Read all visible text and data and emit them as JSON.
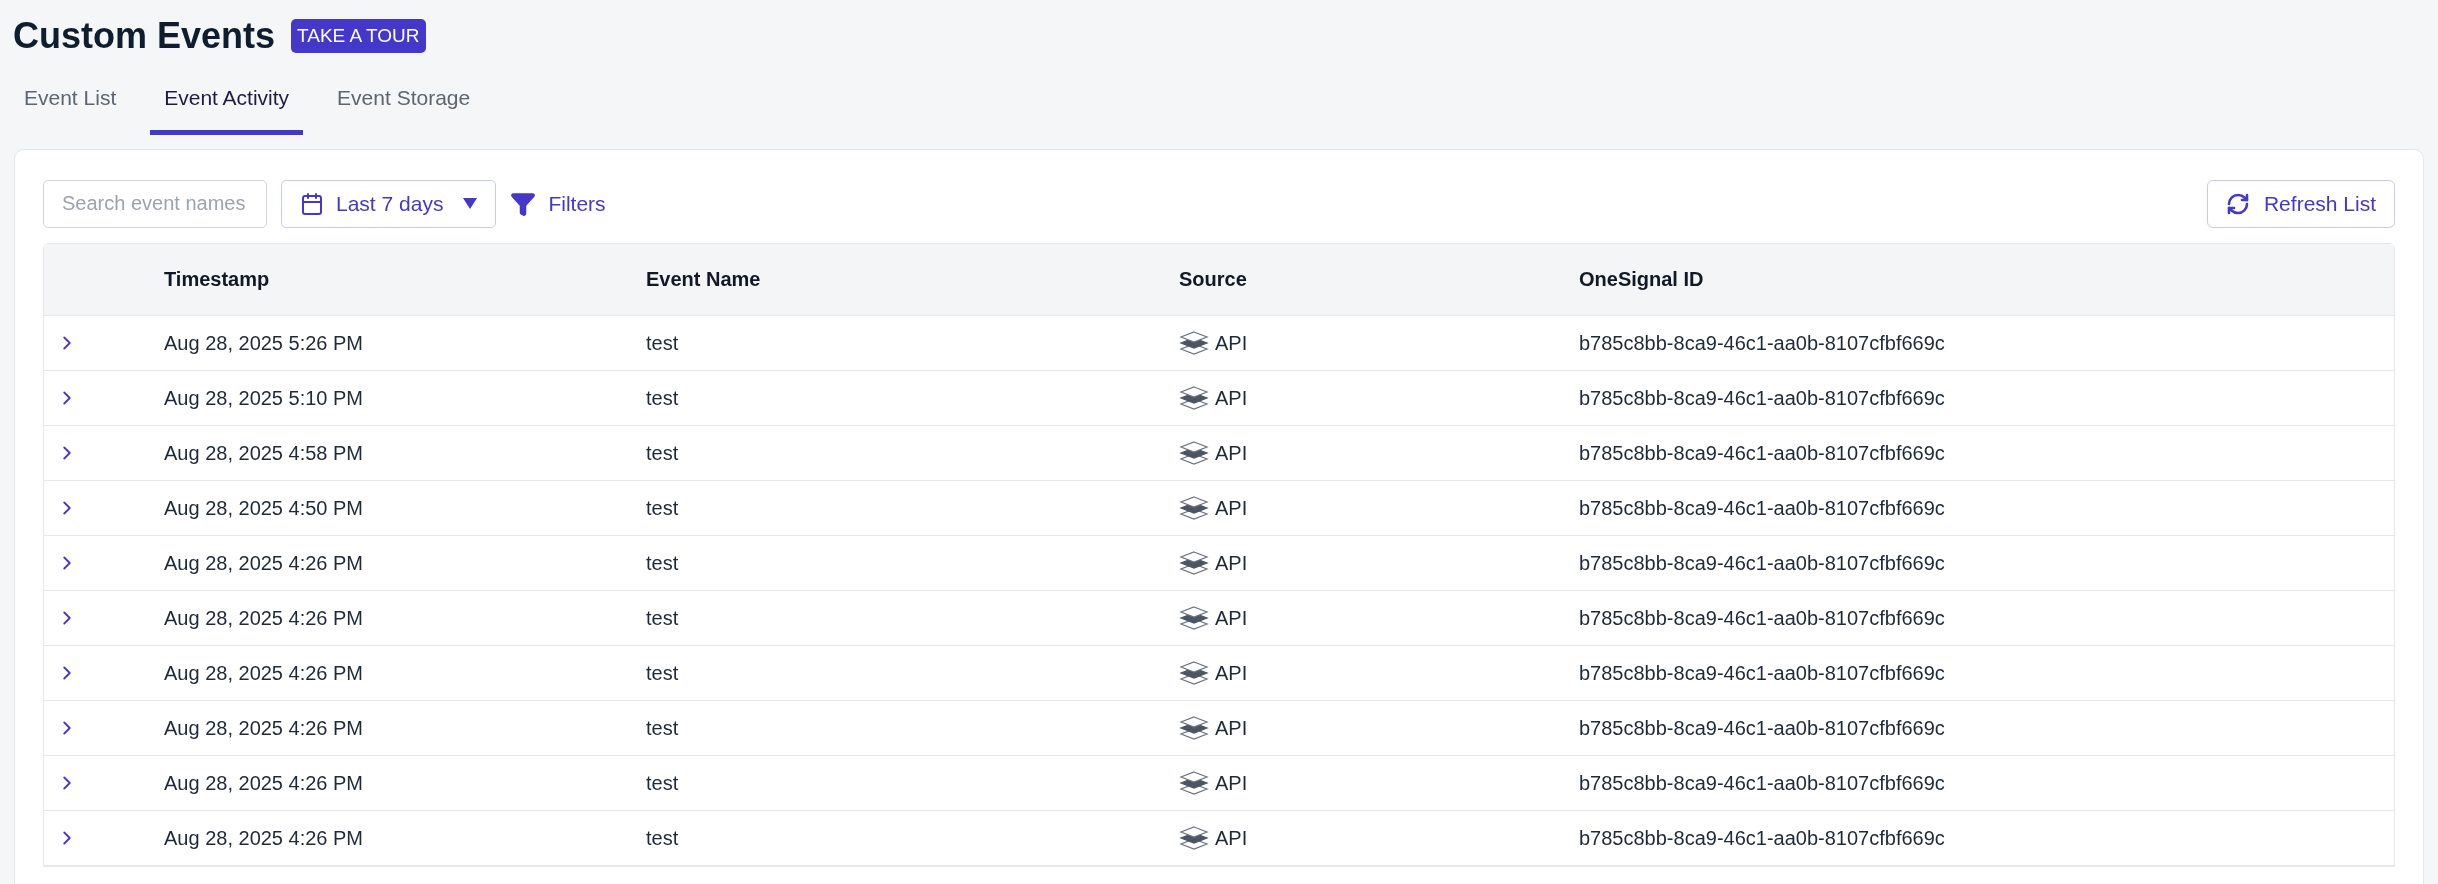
{
  "page": {
    "title": "Custom Events",
    "tour_button": "TAKE A TOUR"
  },
  "tabs": [
    {
      "label": "Event List",
      "selected": false
    },
    {
      "label": "Event Activity",
      "selected": true
    },
    {
      "label": "Event Storage",
      "selected": false
    }
  ],
  "toolbar": {
    "search": {
      "placeholder": "Search event names"
    },
    "date_range": "Last 7 days",
    "filters": "Filters",
    "refresh": "Refresh List"
  },
  "table": {
    "columns": [
      "Timestamp",
      "Event Name",
      "Source",
      "OneSignal ID"
    ],
    "rows": [
      {
        "timestamp": "Aug 28, 2025 5:26 PM",
        "event_name": "test",
        "source": "API",
        "onesignal_id": "b785c8bb-8ca9-46c1-aa0b-8107cfbf669c"
      },
      {
        "timestamp": "Aug 28, 2025 5:10 PM",
        "event_name": "test",
        "source": "API",
        "onesignal_id": "b785c8bb-8ca9-46c1-aa0b-8107cfbf669c"
      },
      {
        "timestamp": "Aug 28, 2025 4:58 PM",
        "event_name": "test",
        "source": "API",
        "onesignal_id": "b785c8bb-8ca9-46c1-aa0b-8107cfbf669c"
      },
      {
        "timestamp": "Aug 28, 2025 4:50 PM",
        "event_name": "test",
        "source": "API",
        "onesignal_id": "b785c8bb-8ca9-46c1-aa0b-8107cfbf669c"
      },
      {
        "timestamp": "Aug 28, 2025 4:26 PM",
        "event_name": "test",
        "source": "API",
        "onesignal_id": "b785c8bb-8ca9-46c1-aa0b-8107cfbf669c"
      },
      {
        "timestamp": "Aug 28, 2025 4:26 PM",
        "event_name": "test",
        "source": "API",
        "onesignal_id": "b785c8bb-8ca9-46c1-aa0b-8107cfbf669c"
      },
      {
        "timestamp": "Aug 28, 2025 4:26 PM",
        "event_name": "test",
        "source": "API",
        "onesignal_id": "b785c8bb-8ca9-46c1-aa0b-8107cfbf669c"
      },
      {
        "timestamp": "Aug 28, 2025 4:26 PM",
        "event_name": "test",
        "source": "API",
        "onesignal_id": "b785c8bb-8ca9-46c1-aa0b-8107cfbf669c"
      },
      {
        "timestamp": "Aug 28, 2025 4:26 PM",
        "event_name": "test",
        "source": "API",
        "onesignal_id": "b785c8bb-8ca9-46c1-aa0b-8107cfbf669c"
      },
      {
        "timestamp": "Aug 28, 2025 4:26 PM",
        "event_name": "test",
        "source": "API",
        "onesignal_id": "b785c8bb-8ca9-46c1-aa0b-8107cfbf669c"
      }
    ]
  }
}
